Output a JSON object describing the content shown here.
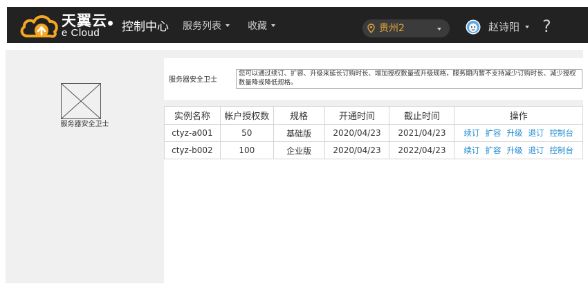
{
  "header": {
    "logo_cn": "天翼云",
    "logo_en": "e Cloud",
    "console_title": "控制中心",
    "nav": [
      {
        "label": "服务列表"
      },
      {
        "label": "收藏"
      }
    ],
    "region": "贵州2",
    "user_name": "赵诗阳",
    "help_label": "?"
  },
  "sidebar": {
    "product_name": "服务器安全卫士"
  },
  "main": {
    "section_title": "服务器安全卫士",
    "notice": "您可以通过续订、扩容、升级来延长订购时长、增加授权数量或升级规格，服务期内暂不支持减少订购时长、减少授权数量降或降低规格。",
    "table": {
      "headers": [
        "实例名称",
        "帐户授权数",
        "规格",
        "开通时间",
        "截止时间",
        "操作"
      ],
      "rows": [
        {
          "name": "ctyz-a001",
          "licenses": "50",
          "spec": "基础版",
          "start": "2020/04/23",
          "end": "2021/04/23"
        },
        {
          "name": "ctyz-b002",
          "licenses": "100",
          "spec": "企业版",
          "start": "2020/04/23",
          "end": "2022/04/23"
        }
      ],
      "actions": [
        "续订",
        "扩容",
        "升级",
        "退订",
        "控制台"
      ]
    }
  },
  "colors": {
    "topbar": "#222222",
    "region_text": "#e2a63a",
    "logo_orange": "#f5a623",
    "link": "#1a89d0",
    "panel_bg": "#f0f0f0"
  }
}
